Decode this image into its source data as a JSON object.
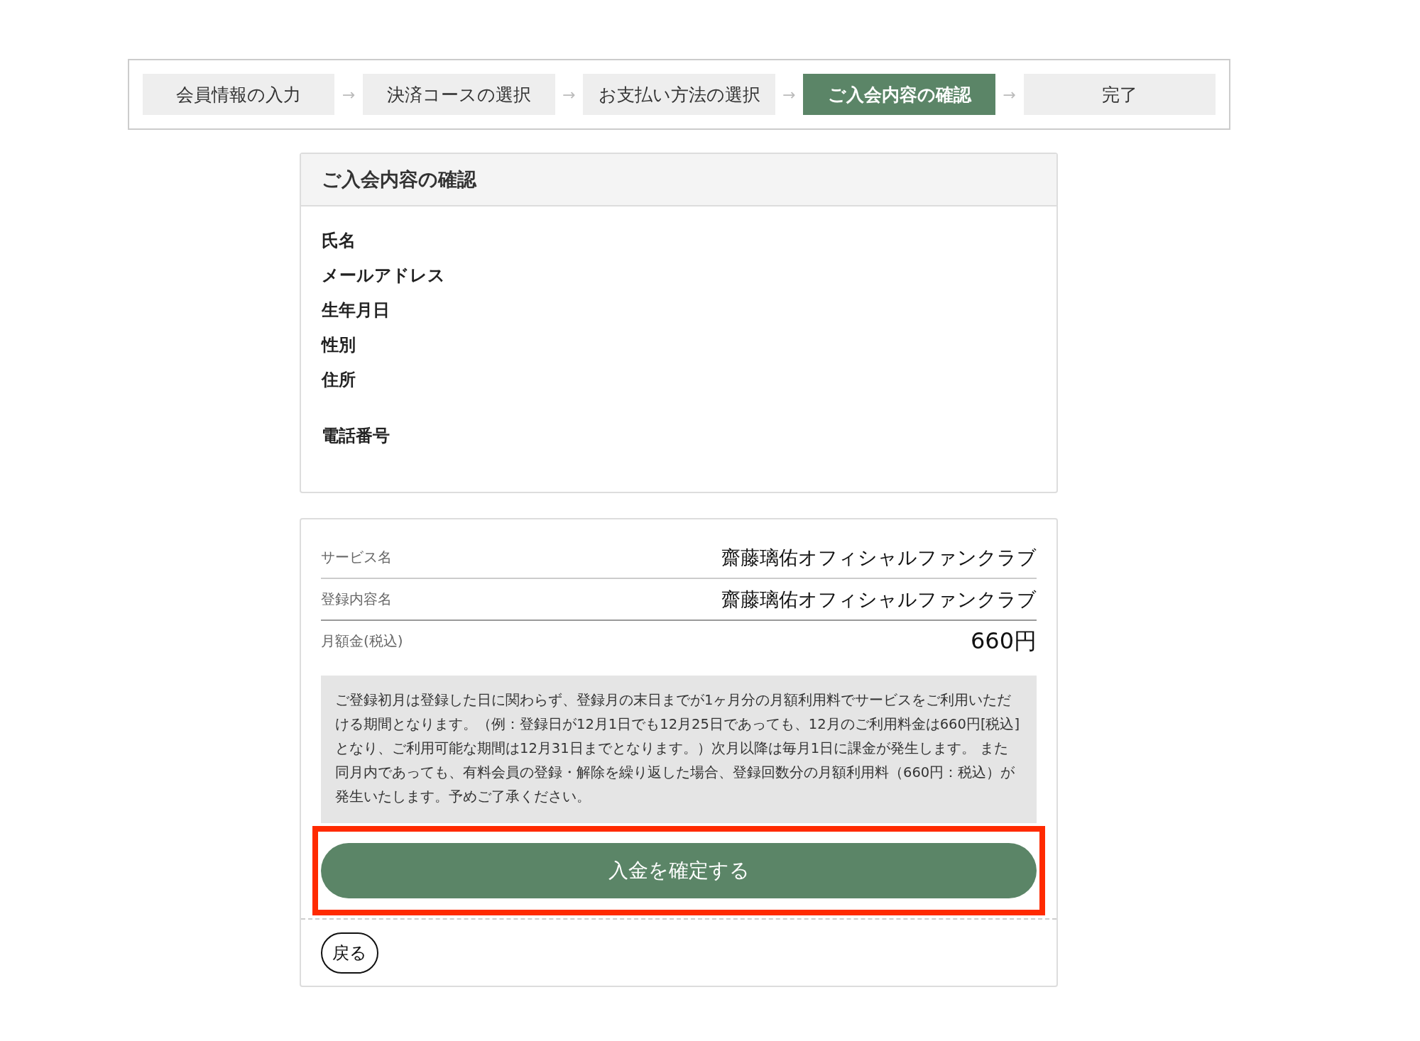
{
  "steps": [
    {
      "label": "会員情報の入力",
      "selected": false
    },
    {
      "label": "決済コースの選択",
      "selected": false
    },
    {
      "label": "お支払い方法の選択",
      "selected": false
    },
    {
      "label": "ご入会内容の確認",
      "selected": true
    },
    {
      "label": "完了",
      "selected": false
    }
  ],
  "step_separator": "→",
  "confirmation": {
    "title": "ご入会内容の確認",
    "fields": [
      {
        "label": "氏名",
        "kind": "line"
      },
      {
        "label": "メールアドレス",
        "kind": "line"
      },
      {
        "label": "生年月日",
        "kind": "line"
      },
      {
        "label": "性別",
        "kind": "line"
      },
      {
        "label": "住所",
        "kind": "address"
      },
      {
        "label": "電話番号",
        "kind": "line"
      }
    ]
  },
  "summary": {
    "rows": [
      {
        "label": "サービス名",
        "value": "齋藤璃佑オフィシャルファンクラブ",
        "kind": "text"
      },
      {
        "label": "登録内容名",
        "value": "齋藤璃佑オフィシャルファンクラブ",
        "kind": "text"
      },
      {
        "label": "月額金(税込)",
        "value": "660円",
        "kind": "price"
      }
    ],
    "notice": "ご登録初月は登録した日に関わらず、登録月の末日までが1ヶ月分の月額利用料でサービスをご利用いただける期間となります。（例：登録日が12月1日でも12月25日であっても、12月のご利用料金は660円[税込]となり、ご利用可能な期間は12月31日までとなります。）次月以降は毎月1日に課金が発生します。 また同月内であっても、有料会員の登録・解除を繰り返した場合、登録回数分の月額利用料（660円：税込）が発生いたします。予めご了承ください。",
    "confirm_button": "入金を確定する",
    "back_button": "戻る"
  }
}
